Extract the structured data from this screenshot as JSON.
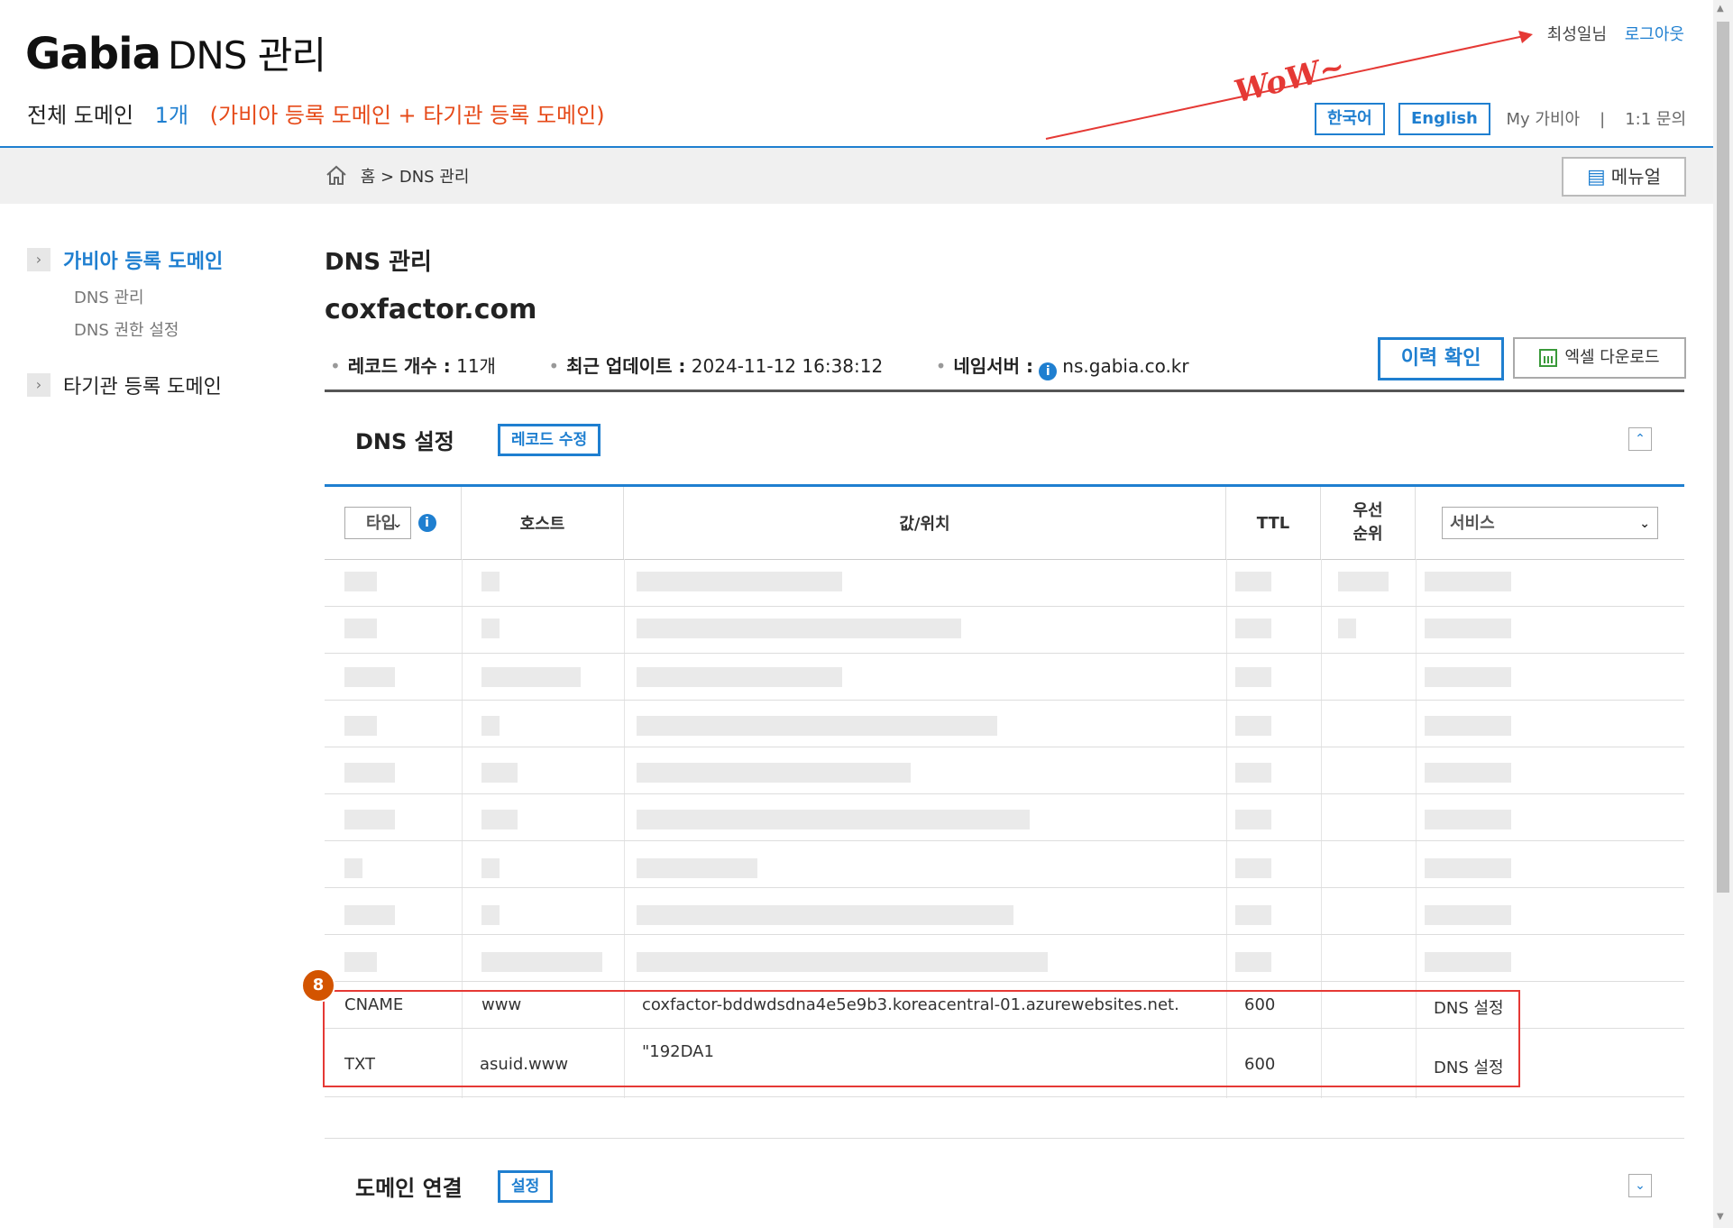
{
  "header": {
    "brand": "Gabia",
    "title": "DNS 관리",
    "summary_label": "전체 도메인",
    "summary_count": "1개",
    "summary_desc": "(가비아 등록 도메인 + 타기관 등록 도메인)",
    "user_name": "최성일님",
    "logout": "로그아웃",
    "lang_ko": "한국어",
    "lang_en": "English",
    "my_gabia": "My 가비아",
    "separator": "|",
    "inquiry": "1:1 문의"
  },
  "annotation": {
    "text": "WoW~",
    "color": "#e53935",
    "badge": "8"
  },
  "breadcrumb": {
    "home": "홈",
    "sep": ">",
    "current": "DNS 관리"
  },
  "manual_button": "메뉴얼",
  "sidebar": {
    "items": [
      {
        "label": "가비아 등록 도메인",
        "active": true,
        "children": [
          {
            "label": "DNS 관리"
          },
          {
            "label": "DNS 권한 설정"
          }
        ]
      },
      {
        "label": "타기관 등록 도메인",
        "active": false
      }
    ]
  },
  "main": {
    "heading": "DNS 관리",
    "domain": "coxfactor.com",
    "meta": {
      "records_label": "레코드 개수 :",
      "records_value": "11개",
      "updated_label": "최근 업데이트 :",
      "updated_value": "2024-11-12 16:38:12",
      "ns_label": "네임서버 :",
      "ns_value": "ns.gabia.co.kr"
    },
    "history_button": "이력 확인",
    "excel_button": "엑셀 다운로드",
    "dns_section": {
      "title": "DNS 설정",
      "edit_button": "레코드 수정"
    },
    "table": {
      "type_select": "타입",
      "columns": {
        "host": "호스트",
        "value": "값/위치",
        "ttl": "TTL",
        "priority_l1": "우선",
        "priority_l2": "순위"
      },
      "service_select": "서비스",
      "visible_rows": [
        {
          "type": "CNAME",
          "host": "www",
          "value": "coxfactor-bddwdsdna4e5e9b3.koreacentral-01.azurewebsites.net.",
          "ttl": "600",
          "priority": "",
          "service": "DNS 설정"
        },
        {
          "type": "TXT",
          "host": "asuid.www",
          "value": "\"192DA1",
          "ttl": "600",
          "priority": "",
          "service": "DNS 설정"
        }
      ]
    },
    "connect_section": {
      "title": "도메인 연결",
      "button": "설정"
    }
  },
  "colors": {
    "accent": "#1f7fd0",
    "highlight_text": "#e64a19",
    "annotation_red": "#e53935"
  }
}
